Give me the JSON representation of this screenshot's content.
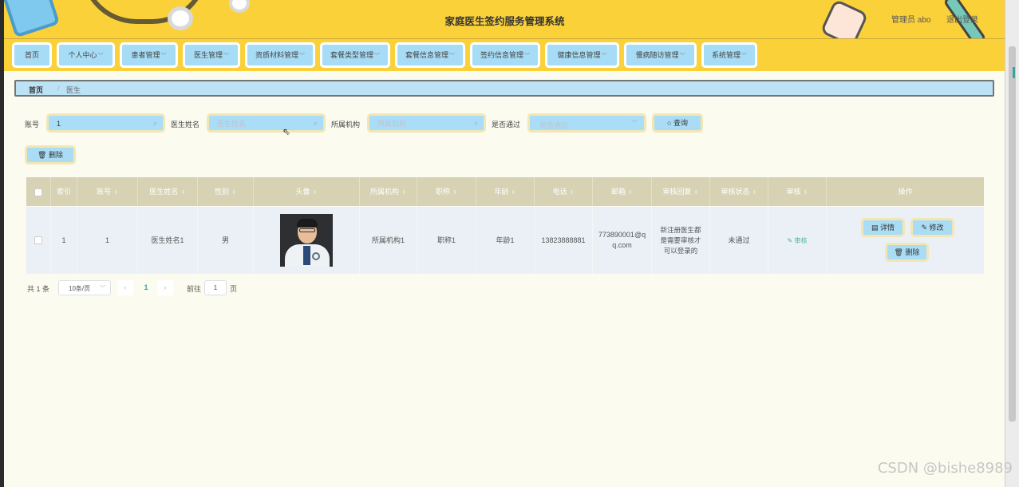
{
  "header": {
    "title": "家庭医生签约服务管理系统",
    "admin_label": "管理员 abo",
    "logout_label": "退出登录"
  },
  "nav": {
    "items": [
      {
        "label": "首页",
        "has_caret": false
      },
      {
        "label": "个人中心",
        "has_caret": true
      },
      {
        "label": "患者管理",
        "has_caret": true
      },
      {
        "label": "医生管理",
        "has_caret": true
      },
      {
        "label": "资质材料管理",
        "has_caret": true
      },
      {
        "label": "套餐类型管理",
        "has_caret": true
      },
      {
        "label": "套餐信息管理",
        "has_caret": true
      },
      {
        "label": "签约信息管理",
        "has_caret": true
      },
      {
        "label": "健康信息管理",
        "has_caret": true
      },
      {
        "label": "慢病随访管理",
        "has_caret": true
      },
      {
        "label": "系统管理",
        "has_caret": true
      }
    ]
  },
  "breadcrumb": {
    "home": "首页",
    "separator": "/",
    "current": "医生"
  },
  "search": {
    "account_label": "账号",
    "account_value": "1",
    "doctor_name_label": "医生姓名",
    "doctor_name_placeholder": "医生姓名",
    "institution_label": "所属机构",
    "institution_placeholder": "所属机构",
    "passed_label": "是否通过",
    "passed_placeholder": "是否通过",
    "search_button": "查询"
  },
  "actions": {
    "delete_button": "删除"
  },
  "table": {
    "columns": [
      "索引",
      "账号",
      "医生姓名",
      "性别",
      "头像",
      "所属机构",
      "职称",
      "年龄",
      "电话",
      "邮箱",
      "审核回复",
      "审核状态",
      "审核",
      "操作"
    ],
    "rows": [
      {
        "index": "1",
        "account": "1",
        "doctor_name": "医生姓名1",
        "gender": "男",
        "institution": "所属机构1",
        "title": "职称1",
        "age": "年龄1",
        "phone": "13823888881",
        "email": "773890001@qq.com",
        "audit_reply": "新注册医生都是需要审核才可以登录的",
        "audit_status": "未通过",
        "audit_link": "审核",
        "op_detail": "详情",
        "op_edit": "修改",
        "op_delete": "删除"
      }
    ]
  },
  "pagination": {
    "total": "共 1 条",
    "page_size": "10条/页",
    "current_page": "1",
    "goto_label": "前往",
    "goto_value": "1",
    "page_unit": "页"
  },
  "watermark": "CSDN @bishe8989"
}
